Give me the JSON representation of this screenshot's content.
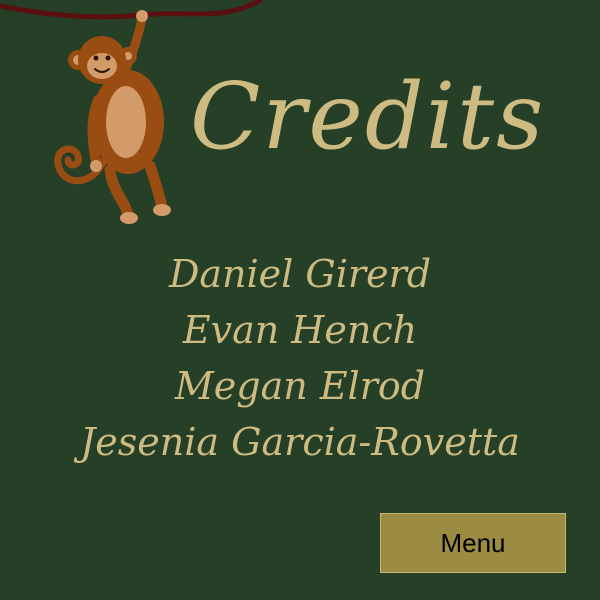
{
  "screen": {
    "title": "Credits"
  },
  "credits": {
    "names": [
      "Daniel Girerd",
      "Evan Hench",
      "Megan Elrod",
      "Jesenia Garcia-Rovetta"
    ]
  },
  "buttons": {
    "menu_label": "Menu"
  },
  "icons": {
    "mascot": "hanging-monkey-icon",
    "vine": "vine-branch"
  },
  "colors": {
    "background": "#263f27",
    "text": "#cdbb82",
    "button": "#9c8b42",
    "vine": "#5a1010",
    "monkey_fur": "#9a4d12",
    "monkey_skin": "#d39a6a"
  }
}
